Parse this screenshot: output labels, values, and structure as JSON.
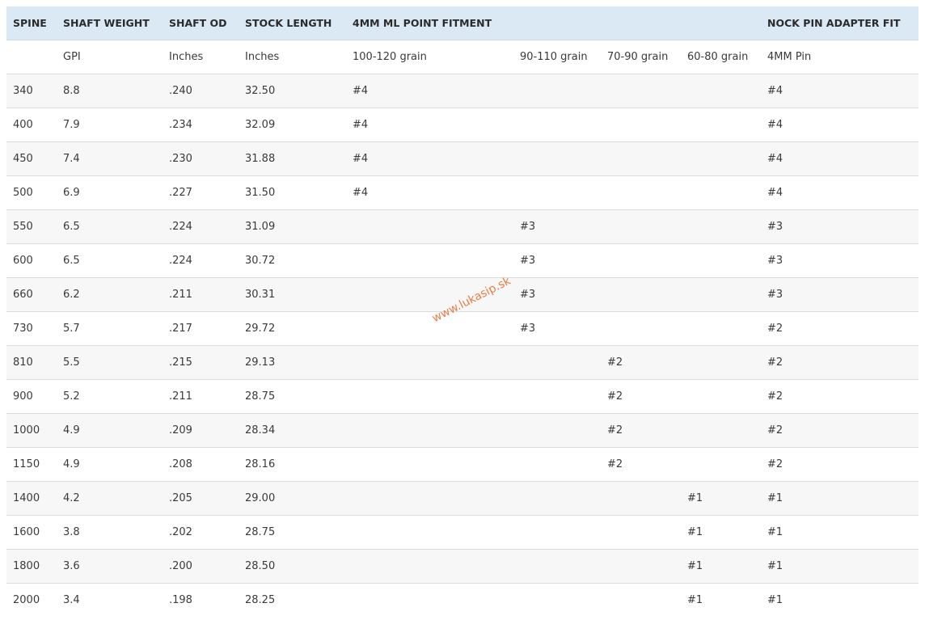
{
  "table": {
    "headers": [
      "SPINE",
      "SHAFT WEIGHT",
      "SHAFT OD",
      "STOCK LENGTH",
      "4MM ML POINT FITMENT",
      "",
      "",
      "",
      "NOCK PIN ADAPTER FIT"
    ],
    "units": [
      "",
      "GPI",
      "Inches",
      "Inches",
      "100-120 grain",
      "90-110 grain",
      "70-90 grain",
      "60-80 grain",
      "4MM Pin"
    ],
    "rows": [
      [
        "340",
        "8.8",
        ".240",
        "32.50",
        "#4",
        "",
        "",
        "",
        "#4"
      ],
      [
        "400",
        "7.9",
        ".234",
        "32.09",
        "#4",
        "",
        "",
        "",
        "#4"
      ],
      [
        "450",
        "7.4",
        ".230",
        "31.88",
        "#4",
        "",
        "",
        "",
        "#4"
      ],
      [
        "500",
        "6.9",
        ".227",
        "31.50",
        "#4",
        "",
        "",
        "",
        "#4"
      ],
      [
        "550",
        "6.5",
        ".224",
        "31.09",
        "",
        "#3",
        "",
        "",
        "#3"
      ],
      [
        "600",
        "6.5",
        ".224",
        "30.72",
        "",
        "#3",
        "",
        "",
        "#3"
      ],
      [
        "660",
        "6.2",
        ".211",
        "30.31",
        "",
        "#3",
        "",
        "",
        "#3"
      ],
      [
        "730",
        "5.7",
        ".217",
        "29.72",
        "",
        "#3",
        "",
        "",
        "#2"
      ],
      [
        "810",
        "5.5",
        ".215",
        "29.13",
        "",
        "",
        "#2",
        "",
        "#2"
      ],
      [
        "900",
        "5.2",
        ".211",
        "28.75",
        "",
        "",
        "#2",
        "",
        "#2"
      ],
      [
        "1000",
        "4.9",
        ".209",
        "28.34",
        "",
        "",
        "#2",
        "",
        "#2"
      ],
      [
        "1150",
        "4.9",
        ".208",
        "28.16",
        "",
        "",
        "#2",
        "",
        "#2"
      ],
      [
        "1400",
        "4.2",
        ".205",
        "29.00",
        "",
        "",
        "",
        "#1",
        "#1"
      ],
      [
        "1600",
        "3.8",
        ".202",
        "28.75",
        "",
        "",
        "",
        "#1",
        "#1"
      ],
      [
        "1800",
        "3.6",
        ".200",
        "28.50",
        "",
        "",
        "",
        "#1",
        "#1"
      ],
      [
        "2000",
        "3.4",
        ".198",
        "28.25",
        "",
        "",
        "",
        "#1",
        "#1"
      ]
    ]
  },
  "watermark": {
    "text": "www.lukasip.sk",
    "color": "#e8773a"
  },
  "colors": {
    "header_bg": "#dbe9f4",
    "row_alt_bg": "#f7f7f7",
    "border": "#dcdcdc"
  }
}
